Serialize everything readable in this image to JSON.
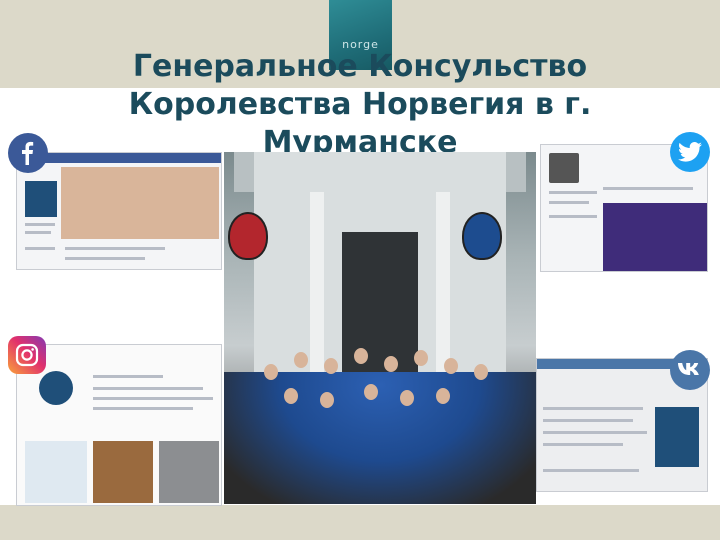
{
  "header": {
    "logo_text": "norge",
    "title_line1": "Генеральное Консульство",
    "title_line2": "Королевства Норвегия в г.",
    "title_line3": "Мурманске"
  },
  "icons": {
    "facebook": "facebook-icon",
    "twitter": "twitter-icon",
    "instagram": "instagram-icon",
    "vk": "vk-icon"
  },
  "colors": {
    "title": "#1b4b5c",
    "band": "#dcd9c9",
    "logo": "#1f6d78",
    "facebook": "#3b5998",
    "twitter": "#1da1f2",
    "vk": "#4a76a8"
  }
}
